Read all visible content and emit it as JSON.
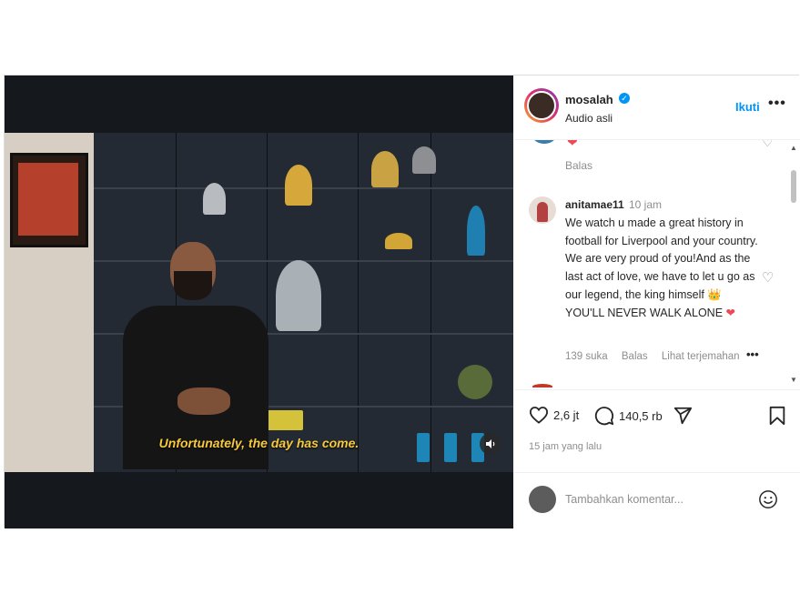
{
  "video": {
    "subtitle": "Unfortunately, the day has come.",
    "mute_icon": "speaker-icon"
  },
  "header": {
    "username": "mosalah",
    "verified_mark": "✓",
    "audio": "Audio asli",
    "follow_label": "Ikuti",
    "more_label": "•••"
  },
  "comments": {
    "prev_reply_label": "Balas",
    "items": [
      {
        "username": "anitamae11",
        "time": "10 jam",
        "text_main": "We watch u made a great history in football for Liverpool and your country. We are very proud of you!And as the last act of love, we have to let u go as our legend, the king himself 👑 YOU'LL NEVER WALK ALONE",
        "text_heart": "❤",
        "likes": "139 suka",
        "reply_label": "Balas",
        "translate_label": "Lihat terjemahan",
        "more_label": "•••"
      }
    ]
  },
  "actions": {
    "likes": "2,6 jt",
    "comments": "140,5 rb",
    "time_ago": "15 jam yang lalu"
  },
  "add_comment": {
    "placeholder": "Tambahkan komentar..."
  },
  "colors": {
    "accent": "#0095f6",
    "heart_red": "#ed4956",
    "subtitle_yellow": "#f7c93b"
  }
}
